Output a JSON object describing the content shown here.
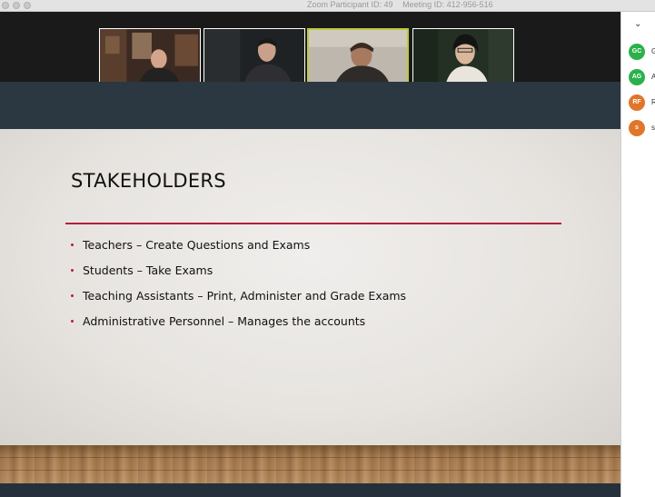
{
  "window": {
    "participant_id": "Zoom Participant ID: 49",
    "meeting_id": "Meeting ID: 412-956-516"
  },
  "video_tiles": [
    {
      "name": "video-tile-1",
      "active": false
    },
    {
      "name": "video-tile-2",
      "active": false
    },
    {
      "name": "video-tile-3",
      "active": true
    },
    {
      "name": "video-tile-4",
      "active": false
    }
  ],
  "slide": {
    "title": "STAKEHOLDERS",
    "bullets": [
      "Teachers – Create Questions and Exams",
      "Students – Take Exams",
      "Teaching Assistants – Print, Administer and Grade Exams",
      "Administrative Personnel – Manages the accounts"
    ],
    "accent_color": "#b21f3c"
  },
  "participants": [
    {
      "initials": "GC",
      "name": "G",
      "color": "#2bb14a"
    },
    {
      "initials": "AG",
      "name": "A",
      "color": "#2bb14a"
    },
    {
      "initials": "RF",
      "name": "R",
      "color": "#e0762a"
    },
    {
      "initials": "s",
      "name": "s",
      "color": "#e0762a"
    }
  ],
  "icons": {
    "panel_collapse": "chevron-down-icon"
  }
}
